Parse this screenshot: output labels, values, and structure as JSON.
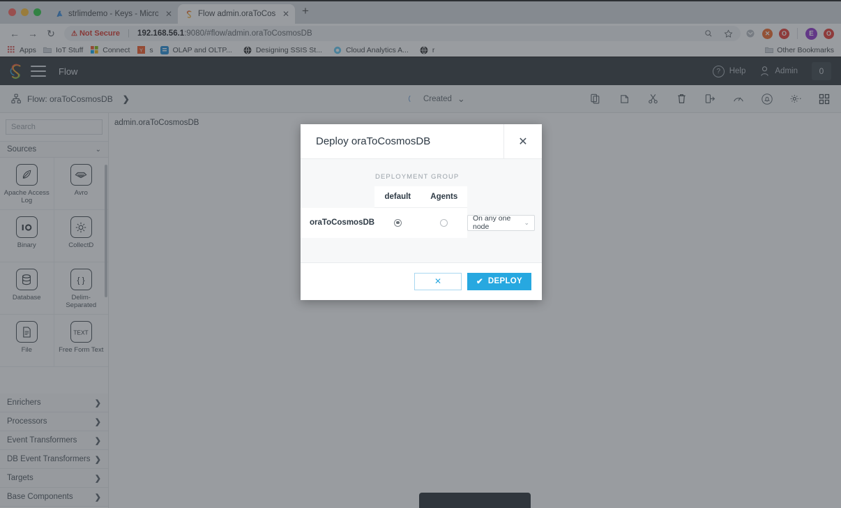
{
  "browser": {
    "tabs": [
      {
        "title": "strlimdemo - Keys - Microsoft",
        "favicon": "azure-icon",
        "active": false,
        "close": "✕"
      },
      {
        "title": "Flow admin.oraToCosmosDB",
        "favicon": "striim-icon",
        "active": true,
        "close": "✕"
      }
    ],
    "new_tab_label": "+",
    "nav": {
      "back": "←",
      "forward": "→",
      "reload": "↻"
    },
    "omnibox": {
      "security_label": "Not Secure",
      "warning_glyph": "⚠",
      "separator": "|",
      "url_host": "192.168.56.1",
      "url_rest": ":9080/#flow/admin.oraToCosmosDB"
    },
    "omnibox_icons": [
      "zoom-icon",
      "star-icon",
      "pocket-icon",
      "blocker-icon",
      "opera-icon",
      "profile-avatar",
      "extension-icon"
    ],
    "profile_initial": "E",
    "bookmarks": [
      {
        "label": "Apps",
        "icon": "apps-grid-icon"
      },
      {
        "label": "IoT Stuff",
        "icon": "folder-icon"
      },
      {
        "label": "Connect",
        "icon": "microsoft-icon"
      },
      {
        "label": "s",
        "icon": "yahoo-icon"
      },
      {
        "label": "OLAP and OLTP...",
        "icon": "blue-doc-icon"
      },
      {
        "label": "Designing SSIS St...",
        "icon": "globe-icon"
      },
      {
        "label": "Cloud Analytics A...",
        "icon": "blue-ring-icon"
      },
      {
        "label": "r",
        "icon": "globe-icon"
      }
    ],
    "other_bookmarks": {
      "label": "Other Bookmarks",
      "icon": "folder-icon"
    }
  },
  "app": {
    "header": {
      "logo": "striim-logo",
      "menu_icon": "hamburger-icon",
      "title": "Flow",
      "help_label": "Help",
      "help_icon": "question-circle-icon",
      "user_label": "Admin",
      "user_icon": "user-icon",
      "badge_count": "0"
    },
    "subheader": {
      "flow_icon": "flow-node-icon",
      "breadcrumb": "Flow: oraToCosmosDB",
      "breadcrumb_chevron": "❯",
      "status_label": "Created",
      "status_chevron": "⌄",
      "spinner": "loading-spinner",
      "tools": [
        {
          "name": "copy-icon"
        },
        {
          "name": "paste-icon"
        },
        {
          "name": "cut-icon"
        },
        {
          "name": "trash-icon"
        },
        {
          "name": "export-icon"
        },
        {
          "name": "monitor-gauge-icon"
        },
        {
          "name": "alert-bell-icon"
        },
        {
          "name": "settings-gear-icon"
        },
        {
          "name": "grid-view-icon"
        }
      ]
    },
    "sidebar": {
      "search_placeholder": "Search",
      "section": {
        "label": "Sources",
        "chevron": "⌄"
      },
      "palette": [
        {
          "label": "Apache Access Log",
          "icon": "feather-quill-icon"
        },
        {
          "label": "Avro",
          "icon": "avro-icon"
        },
        {
          "label": "Binary",
          "icon": "binary-io-icon"
        },
        {
          "label": "CollectD",
          "icon": "collectd-icon"
        },
        {
          "label": "Database",
          "icon": "database-icon"
        },
        {
          "label": "Delim-Separated",
          "icon": "braces-icon"
        },
        {
          "label": "File",
          "icon": "file-lines-icon"
        },
        {
          "label": "Free Form Text",
          "icon": "text-icon"
        }
      ],
      "nav": [
        {
          "label": "Enrichers",
          "chevron": "❯"
        },
        {
          "label": "Processors",
          "chevron": "❯"
        },
        {
          "label": "Event Transformers",
          "chevron": "❯"
        },
        {
          "label": "DB Event Transformers",
          "chevron": "❯"
        },
        {
          "label": "Targets",
          "chevron": "❯"
        },
        {
          "label": "Base Components",
          "chevron": "❯"
        }
      ]
    },
    "canvas": {
      "label": "admin.oraToCosmosDB"
    }
  },
  "modal": {
    "title": "Deploy oraToCosmosDB",
    "close_glyph": "✕",
    "deployment_group_label": "DEPLOYMENT GROUP",
    "columns": [
      "default",
      "Agents"
    ],
    "rows": [
      {
        "name": "oraToCosmosDB",
        "default_selected": true,
        "agents_selected": false,
        "node_option": "On any one node"
      }
    ],
    "select_chevron": "⌄",
    "cancel_glyph": "✕",
    "deploy_label": "DEPLOY",
    "deploy_check": "✔"
  },
  "colors": {
    "accent": "#27a8e0",
    "header_bg": "#2c3338",
    "not_secure": "#d93025",
    "overlay": "#7b7f83"
  }
}
